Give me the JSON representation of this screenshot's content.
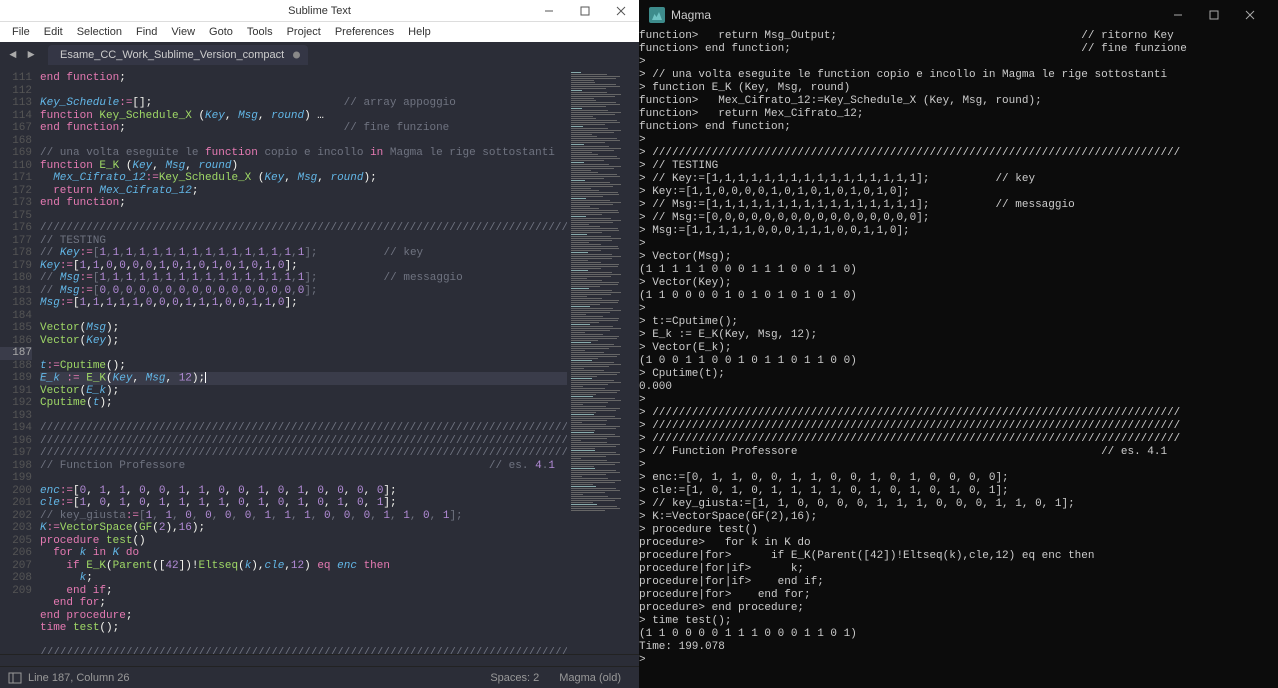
{
  "sublime": {
    "title": "Sublime Text",
    "menu": [
      "File",
      "Edit",
      "Selection",
      "Find",
      "View",
      "Goto",
      "Tools",
      "Project",
      "Preferences",
      "Help"
    ],
    "tab_name": "Esame_CC_Work_Sublime_Version_compact",
    "gutter_start": 111,
    "gutter_count": 47,
    "gutter_labels": [
      "111",
      "112",
      "113",
      "114",
      "167",
      "168",
      "169",
      "110",
      "171",
      "172",
      "173",
      "175",
      "176",
      "177",
      "178",
      "179",
      "180",
      "181",
      "183",
      "184",
      "185",
      "186",
      "187",
      "188",
      "189",
      "191",
      "192",
      "193",
      "194",
      "196",
      "197",
      "198",
      "199",
      "200",
      "201",
      "202",
      "203",
      "205",
      "206",
      "207",
      "208",
      "209"
    ],
    "code": {
      "l0": "end function;",
      "l1": "",
      "l2": "Key_Schedule:=[];                             // array appoggio",
      "l3": "function Key_Schedule_X (Key, Msg, round) …",
      "l4": "end function;                                 // fine funzione",
      "l5": "",
      "l6": "// una volta eseguite le function copio e incollo in Magma le rige sottostanti",
      "l7": "function E_K (Key, Msg, round)",
      "l8": "  Mex_Cifrato_12:=Key_Schedule_X (Key, Msg, round);",
      "l9": "  return Mex_Cifrato_12;",
      "l10": "end function;",
      "l11": "",
      "l12": "////////////////////////////////////////////////////////////////////////////////",
      "l13": "// TESTING",
      "l14": "// Key:=[1,1,1,1,1,1,1,1,1,1,1,1,1,1,1,1];          // key",
      "l15": "Key:=[1,1,0,0,0,0,1,0,1,0,1,0,1,0,1,0];",
      "l16": "// Msg:=[1,1,1,1,1,1,1,1,1,1,1,1,1,1,1,1];          // messaggio",
      "l17": "// Msg:=[0,0,0,0,0,0,0,0,0,0,0,0,0,0,0,0];",
      "l18": "Msg:=[1,1,1,1,1,0,0,0,1,1,1,0,0,1,1,0];",
      "l19": "",
      "l20": "Vector(Msg);",
      "l21": "Vector(Key);",
      "l22": "",
      "l23": "t:=Cputime();",
      "l24": "E_k := E_K(Key, Msg, 12);",
      "l25": "Vector(E_k);",
      "l26": "Cputime(t);",
      "l27": "",
      "l28": "////////////////////////////////////////////////////////////////////////////////",
      "l29": "////////////////////////////////////////////////////////////////////////////////",
      "l30": "////////////////////////////////////////////////////////////////////////////////",
      "l31": "// Function Professore                                              // es. 4.1",
      "l32": "",
      "l33": "enc:=[0, 1, 1, 0, 0, 1, 1, 0, 0, 1, 0, 1, 0, 0, 0, 0];",
      "l34": "cle:=[1, 0, 1, 0, 1, 1, 1, 1, 0, 1, 0, 1, 0, 1, 0, 1];",
      "l35": "// key_giusta:=[1, 1, 0, 0, 0, 0, 1, 1, 1, 0, 0, 0, 1, 1, 0, 1];",
      "l36": "K:=VectorSpace(GF(2),16);",
      "l37": "procedure test()",
      "l38": "  for k in K do",
      "l39": "    if E_K(Parent([42])!Eltseq(k),cle,12) eq enc then",
      "l40": "      k;",
      "l41": "    end if;",
      "l42": "  end for;",
      "l43": "end procedure;",
      "l44": "time test();",
      "l45": "",
      "l46": "////////////////////////////////////////////////////////////////////////////////"
    },
    "status": {
      "pos": "Line 187, Column 26",
      "spaces": "Spaces: 2",
      "syntax": "Magma (old)"
    }
  },
  "magma": {
    "title": "Magma",
    "lines": [
      "function>   return Msg_Output;                                     // ritorno Key",
      "function> end function;                                            // fine funzione",
      ">",
      "> // una volta eseguite le function copio e incollo in Magma le rige sottostanti",
      "> function E_K (Key, Msg, round)",
      "function>   Mex_Cifrato_12:=Key_Schedule_X (Key, Msg, round);",
      "function>   return Mex_Cifrato_12;",
      "function> end function;",
      ">",
      "> ////////////////////////////////////////////////////////////////////////////////",
      "> // TESTING",
      "> // Key:=[1,1,1,1,1,1,1,1,1,1,1,1,1,1,1,1];          // key",
      "> Key:=[1,1,0,0,0,0,1,0,1,0,1,0,1,0,1,0];",
      "> // Msg:=[1,1,1,1,1,1,1,1,1,1,1,1,1,1,1,1];          // messaggio",
      "> // Msg:=[0,0,0,0,0,0,0,0,0,0,0,0,0,0,0,0];",
      "> Msg:=[1,1,1,1,1,0,0,0,1,1,1,0,0,1,1,0];",
      ">",
      "> Vector(Msg);",
      "(1 1 1 1 1 0 0 0 1 1 1 0 0 1 1 0)",
      "> Vector(Key);",
      "(1 1 0 0 0 0 1 0 1 0 1 0 1 0 1 0)",
      ">",
      "> t:=Cputime();",
      "> E_k := E_K(Key, Msg, 12);",
      "> Vector(E_k);",
      "(1 0 0 1 1 0 0 1 0 1 1 0 1 1 0 0)",
      "> Cputime(t);",
      "0.000",
      ">",
      "> ////////////////////////////////////////////////////////////////////////////////",
      "> ////////////////////////////////////////////////////////////////////////////////",
      "> ////////////////////////////////////////////////////////////////////////////////",
      "> // Function Professore                                              // es. 4.1",
      ">",
      "> enc:=[0, 1, 1, 0, 0, 1, 1, 0, 0, 1, 0, 1, 0, 0, 0, 0];",
      "> cle:=[1, 0, 1, 0, 1, 1, 1, 1, 0, 1, 0, 1, 0, 1, 0, 1];",
      "> // key_giusta:=[1, 1, 0, 0, 0, 0, 1, 1, 1, 0, 0, 0, 1, 1, 0, 1];",
      "> K:=VectorSpace(GF(2),16);",
      "> procedure test()",
      "procedure>   for k in K do",
      "procedure|for>      if E_K(Parent([42])!Eltseq(k),cle,12) eq enc then",
      "procedure|for|if>      k;",
      "procedure|for|if>    end if;",
      "procedure|for>    end for;",
      "procedure> end procedure;",
      "> time test();",
      "(1 1 0 0 0 0 1 1 1 0 0 0 1 1 0 1)",
      "Time: 199.078",
      "> "
    ]
  }
}
